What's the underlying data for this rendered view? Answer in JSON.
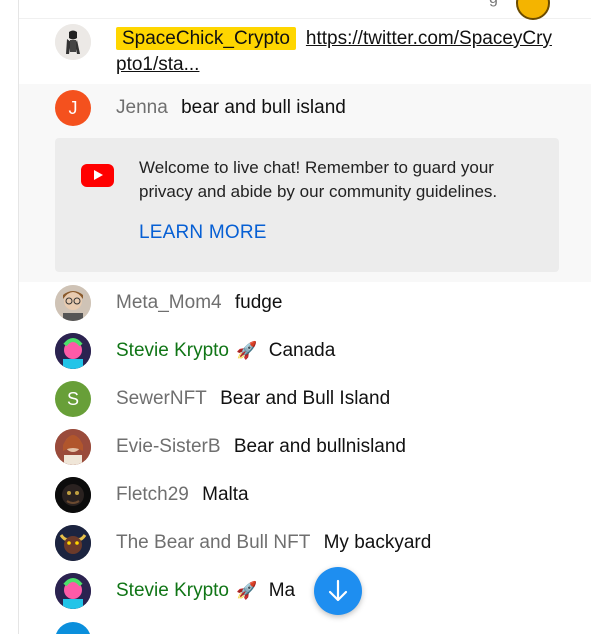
{
  "top": {
    "partial_text": "g"
  },
  "messages": [
    {
      "author": "SpaceChick_Crypto",
      "text": "https://twitter.com/SpaceyCrypto1/sta...",
      "author_style": "highlight",
      "avatar_icon": "astronaut-avatar"
    },
    {
      "author": "Jenna",
      "text": "bear and bull island",
      "author_style": "normal",
      "avatar_letter": "J",
      "avatar_color": "#f4511e"
    },
    {
      "author": "Meta_Mom4",
      "text": "fudge",
      "author_style": "normal",
      "avatar_icon": "glasses-person-avatar"
    },
    {
      "author": "Stevie Krypto",
      "badge": "🚀",
      "text": "Canada",
      "author_style": "member",
      "avatar_icon": "colorful-avatar"
    },
    {
      "author": "SewerNFT",
      "text": "Bear and Bull Island",
      "author_style": "normal",
      "avatar_letter": "S",
      "avatar_color": "#689f38"
    },
    {
      "author": "Evie-SisterB",
      "text": "Bear and bullnisland",
      "author_style": "normal",
      "avatar_icon": "woman-avatar"
    },
    {
      "author": "Fletch29",
      "text": "Malta",
      "author_style": "normal",
      "avatar_icon": "dark-avatar"
    },
    {
      "author": "The Bear and Bull NFT",
      "text": "My backyard",
      "author_style": "normal",
      "avatar_icon": "bull-avatar"
    },
    {
      "author": "Stevie Krypto",
      "badge": "🚀",
      "text": "Ma",
      "author_style": "member",
      "avatar_icon": "colorful-avatar"
    }
  ],
  "notice": {
    "text": "Welcome to live chat! Remember to guard your privacy and abide by our community guidelines.",
    "learn_more": "LEARN MORE"
  },
  "colors": {
    "member": "#107516",
    "highlight": "#ffd600",
    "link_blue": "#065fd4",
    "fab": "#1e8ef0"
  },
  "scroll_button": {
    "icon": "arrow-down-icon"
  }
}
